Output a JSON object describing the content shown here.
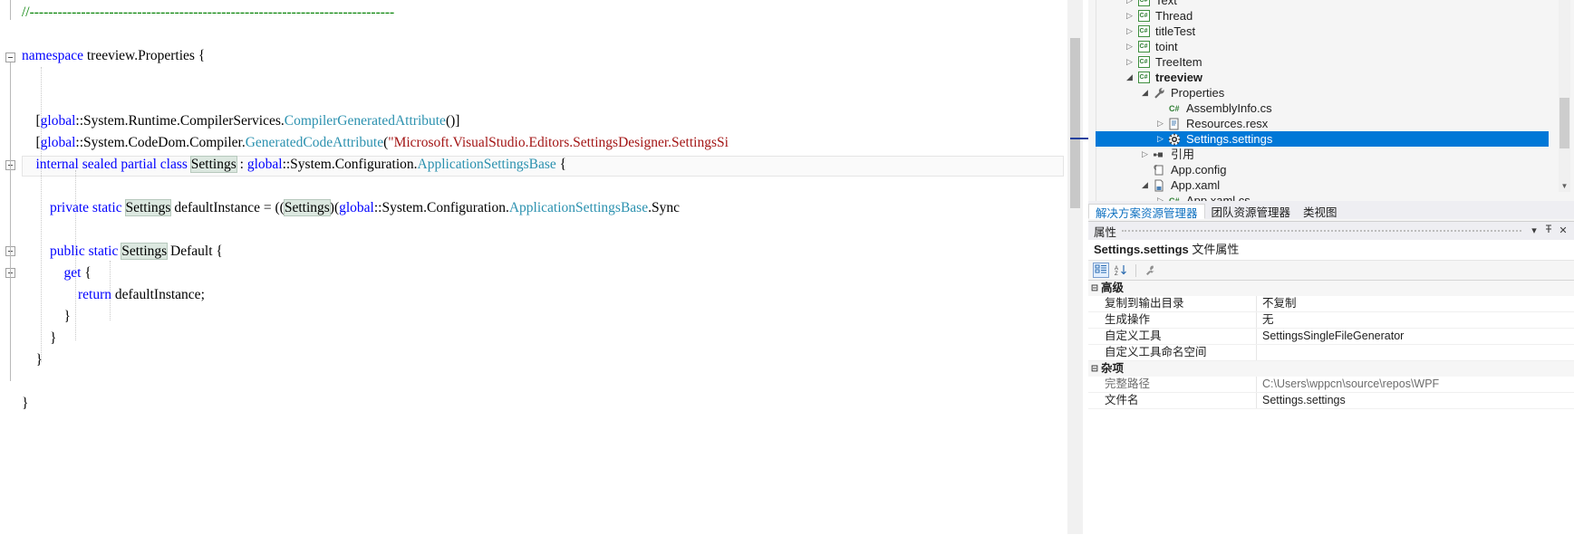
{
  "editor": {
    "lines": [
      {
        "indent": 0,
        "spans": [
          {
            "t": "//------------------------------------------------------------------------------",
            "c": "cmt"
          }
        ]
      },
      {
        "indent": 0,
        "spans": []
      },
      {
        "indent": 0,
        "spans": [
          {
            "t": "namespace",
            "c": "kw"
          },
          {
            "t": " treeview.Properties {",
            "c": "plain"
          }
        ]
      },
      {
        "indent": 0,
        "spans": []
      },
      {
        "indent": 0,
        "spans": []
      },
      {
        "indent": 0,
        "spans": [
          {
            "t": "    [",
            "c": "plain"
          },
          {
            "t": "global",
            "c": "kw"
          },
          {
            "t": "::System.Runtime.CompilerServices.",
            "c": "plain"
          },
          {
            "t": "CompilerGeneratedAttribute",
            "c": "typ"
          },
          {
            "t": "()]",
            "c": "plain"
          }
        ]
      },
      {
        "indent": 0,
        "spans": [
          {
            "t": "    [",
            "c": "plain"
          },
          {
            "t": "global",
            "c": "kw"
          },
          {
            "t": "::System.CodeDom.Compiler.",
            "c": "plain"
          },
          {
            "t": "GeneratedCodeAttribute",
            "c": "typ"
          },
          {
            "t": "(",
            "c": "plain"
          },
          {
            "t": "\"Microsoft.VisualStudio.Editors.SettingsDesigner.SettingsSi",
            "c": "str"
          }
        ]
      },
      {
        "indent": 0,
        "spans": [
          {
            "t": "    ",
            "c": "plain"
          },
          {
            "t": "internal sealed partial class",
            "c": "kw"
          },
          {
            "t": " ",
            "c": "plain"
          },
          {
            "t": "Settings",
            "c": "hl"
          },
          {
            "t": " : ",
            "c": "plain"
          },
          {
            "t": "global",
            "c": "kw"
          },
          {
            "t": "::System.Configuration.",
            "c": "plain"
          },
          {
            "t": "ApplicationSettingsBase",
            "c": "typ"
          },
          {
            "t": " {",
            "c": "plain"
          }
        ]
      },
      {
        "indent": 0,
        "spans": []
      },
      {
        "indent": 0,
        "spans": [
          {
            "t": "        ",
            "c": "plain"
          },
          {
            "t": "private static",
            "c": "kw"
          },
          {
            "t": " ",
            "c": "plain"
          },
          {
            "t": "Settings",
            "c": "hl"
          },
          {
            "t": " defaultInstance = ((",
            "c": "plain"
          },
          {
            "t": "Settings",
            "c": "hl"
          },
          {
            "t": ")(",
            "c": "plain"
          },
          {
            "t": "global",
            "c": "kw"
          },
          {
            "t": "::System.Configuration.",
            "c": "plain"
          },
          {
            "t": "ApplicationSettingsBase",
            "c": "typ"
          },
          {
            "t": ".Sync",
            "c": "plain"
          }
        ]
      },
      {
        "indent": 0,
        "spans": []
      },
      {
        "indent": 0,
        "spans": [
          {
            "t": "        ",
            "c": "plain"
          },
          {
            "t": "public static",
            "c": "kw"
          },
          {
            "t": " ",
            "c": "plain"
          },
          {
            "t": "Settings",
            "c": "hl"
          },
          {
            "t": " Default {",
            "c": "plain"
          }
        ]
      },
      {
        "indent": 0,
        "spans": [
          {
            "t": "            ",
            "c": "plain"
          },
          {
            "t": "get",
            "c": "kw"
          },
          {
            "t": " {",
            "c": "plain"
          }
        ]
      },
      {
        "indent": 0,
        "spans": [
          {
            "t": "                ",
            "c": "plain"
          },
          {
            "t": "return",
            "c": "kw"
          },
          {
            "t": " defaultInstance;",
            "c": "plain"
          }
        ]
      },
      {
        "indent": 0,
        "spans": [
          {
            "t": "            }",
            "c": "plain"
          }
        ]
      },
      {
        "indent": 0,
        "spans": [
          {
            "t": "        }",
            "c": "plain"
          }
        ]
      },
      {
        "indent": 0,
        "spans": [
          {
            "t": "    }",
            "c": "plain"
          }
        ]
      },
      {
        "indent": 0,
        "spans": []
      },
      {
        "indent": 0,
        "spans": [
          {
            "t": "}",
            "c": "plain"
          }
        ]
      }
    ]
  },
  "solution_explorer": {
    "items": [
      {
        "label": "Text",
        "icon": "csharp-file-icon",
        "expander": "collapsed",
        "depth": 1,
        "bold": false,
        "selected": false
      },
      {
        "label": "Thread",
        "icon": "csharp-file-icon",
        "expander": "collapsed",
        "depth": 1,
        "bold": false,
        "selected": false
      },
      {
        "label": "titleTest",
        "icon": "csharp-file-icon",
        "expander": "collapsed",
        "depth": 1,
        "bold": false,
        "selected": false
      },
      {
        "label": "toint",
        "icon": "csharp-file-icon",
        "expander": "collapsed",
        "depth": 1,
        "bold": false,
        "selected": false
      },
      {
        "label": "TreeItem",
        "icon": "csharp-file-icon",
        "expander": "collapsed",
        "depth": 1,
        "bold": false,
        "selected": false
      },
      {
        "label": "treeview",
        "icon": "csharp-project-icon",
        "expander": "expanded",
        "depth": 1,
        "bold": true,
        "selected": false
      },
      {
        "label": "Properties",
        "icon": "wrench-icon",
        "expander": "expanded",
        "depth": 2,
        "bold": false,
        "selected": false
      },
      {
        "label": "AssemblyInfo.cs",
        "icon": "csharp-code-icon",
        "expander": "none",
        "depth": 3,
        "bold": false,
        "selected": false
      },
      {
        "label": "Resources.resx",
        "icon": "resx-icon",
        "expander": "collapsed",
        "depth": 3,
        "bold": false,
        "selected": false
      },
      {
        "label": "Settings.settings",
        "icon": "settings-gear-icon",
        "expander": "collapsed",
        "depth": 3,
        "bold": false,
        "selected": true
      },
      {
        "label": "引用",
        "icon": "references-icon",
        "expander": "collapsed",
        "depth": 2,
        "bold": false,
        "selected": false
      },
      {
        "label": "App.config",
        "icon": "config-icon",
        "expander": "none",
        "depth": 2,
        "bold": false,
        "selected": false
      },
      {
        "label": "App.xaml",
        "icon": "xaml-icon",
        "expander": "expanded",
        "depth": 2,
        "bold": false,
        "selected": false
      },
      {
        "label": "App.xaml.cs",
        "icon": "csharp-code-icon",
        "expander": "collapsed",
        "depth": 3,
        "bold": false,
        "selected": false
      }
    ],
    "scroll_down_icon": "chevron-down-icon"
  },
  "tool_tabs": [
    {
      "label": "解决方案资源管理器",
      "active": true
    },
    {
      "label": "团队资源管理器",
      "active": false
    },
    {
      "label": "类视图",
      "active": false
    }
  ],
  "properties": {
    "title": "属性",
    "window_buttons": [
      {
        "icon": "chevron-down-icon",
        "glyph": "▾"
      },
      {
        "icon": "pin-icon",
        "glyph": "⊣"
      },
      {
        "icon": "close-icon",
        "glyph": "✕"
      }
    ],
    "subject": "Settings.settings",
    "subject_kind": "文件属性",
    "toolbar": [
      {
        "icon": "categorized-view-icon",
        "active": true
      },
      {
        "icon": "alphabetical-sort-icon",
        "active": false
      },
      {
        "icon": "property-pages-icon",
        "active": false
      }
    ],
    "groups": [
      {
        "name": "高级",
        "expander": "expanded",
        "rows": [
          {
            "name": "复制到输出目录",
            "value": "不复制",
            "dim": false
          },
          {
            "name": "生成操作",
            "value": "无",
            "dim": false
          },
          {
            "name": "自定义工具",
            "value": "SettingsSingleFileGenerator",
            "dim": false
          },
          {
            "name": "自定义工具命名空间",
            "value": "",
            "dim": false
          }
        ]
      },
      {
        "name": "杂项",
        "expander": "expanded",
        "rows": [
          {
            "name": "完整路径",
            "value": "C:\\Users\\wppcn\\source\\repos\\WPF",
            "dim": true
          },
          {
            "name": "文件名",
            "value": "Settings.settings",
            "dim": false
          }
        ]
      }
    ]
  },
  "colors": {
    "selection_blue": "#0078d7",
    "keyword": "#0000ff",
    "type": "#2b91af",
    "string": "#a31515",
    "comment": "#008000",
    "highlight": "#dce8e0",
    "connector": "#1f3f9e"
  }
}
